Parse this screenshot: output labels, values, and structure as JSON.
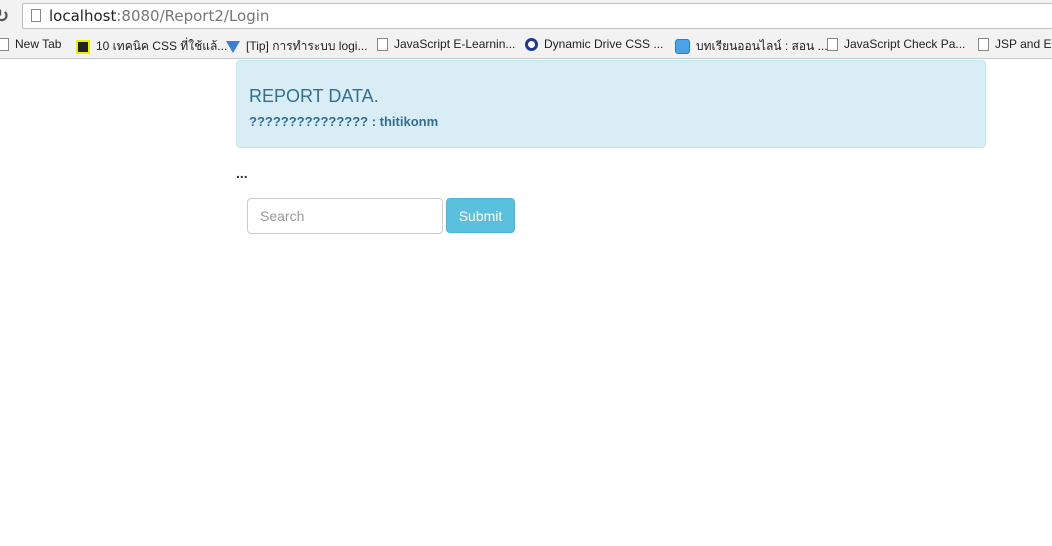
{
  "browser": {
    "url_host": "localhost",
    "url_rest": ":8080/Report2/Login",
    "bookmarks": [
      {
        "label": "New Tab",
        "icon": "page-icon"
      },
      {
        "label": "10 เทคนิค CSS ที่ใช้แล้...",
        "icon": "t-favicon"
      },
      {
        "label": "[Tip] การทำระบบ logi...",
        "icon": "v-favicon"
      },
      {
        "label": "JavaScript E-Learnin...",
        "icon": "page-icon"
      },
      {
        "label": "Dynamic Drive CSS ...",
        "icon": "d-favicon"
      },
      {
        "label": "บทเรียนออนไลน์ : สอน ...",
        "icon": "chat-favicon"
      },
      {
        "label": "JavaScript Check Pa...",
        "icon": "page-icon"
      },
      {
        "label": "JSP and Ec",
        "icon": "page-icon"
      }
    ]
  },
  "alert": {
    "title": "REPORT DATA.",
    "user_line": "??????????????? : thitikonm"
  },
  "dots": "...",
  "search": {
    "placeholder": "Search",
    "value": ""
  },
  "submit_label": "Submit",
  "colors": {
    "alert_bg": "#d9edf7",
    "alert_text": "#31708f",
    "button": "#5bc0de"
  }
}
